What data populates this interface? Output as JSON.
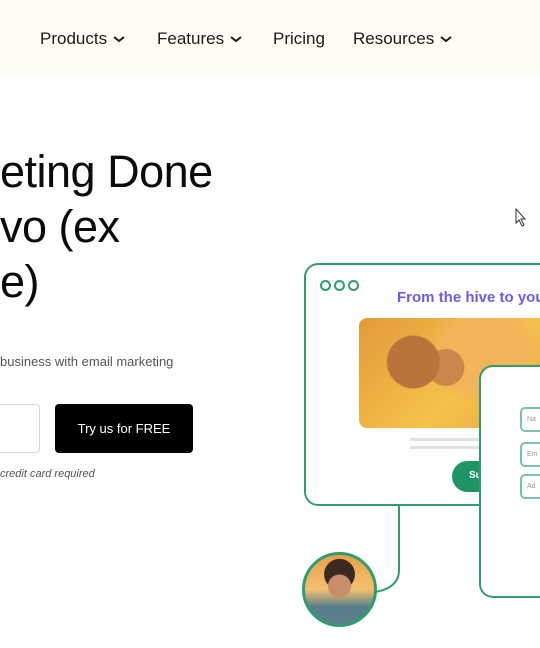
{
  "nav": {
    "items": [
      {
        "label": "Products",
        "dropdown": true
      },
      {
        "label": "Features",
        "dropdown": true
      },
      {
        "label": "Pricing",
        "dropdown": false
      },
      {
        "label": "Resources",
        "dropdown": true
      }
    ]
  },
  "hero": {
    "heading_lines": [
      "eting Done",
      "vo (ex",
      "e)"
    ],
    "subtitle": "business with email marketing",
    "cta_label": "Try us for FREE",
    "note": "credit card required"
  },
  "illustration": {
    "title": "From the hive to you",
    "submit_label": "Su",
    "fields": [
      "Na",
      "Em",
      "Ad"
    ],
    "accent": "#2e9e6b",
    "title_color": "#6c5ce7"
  }
}
